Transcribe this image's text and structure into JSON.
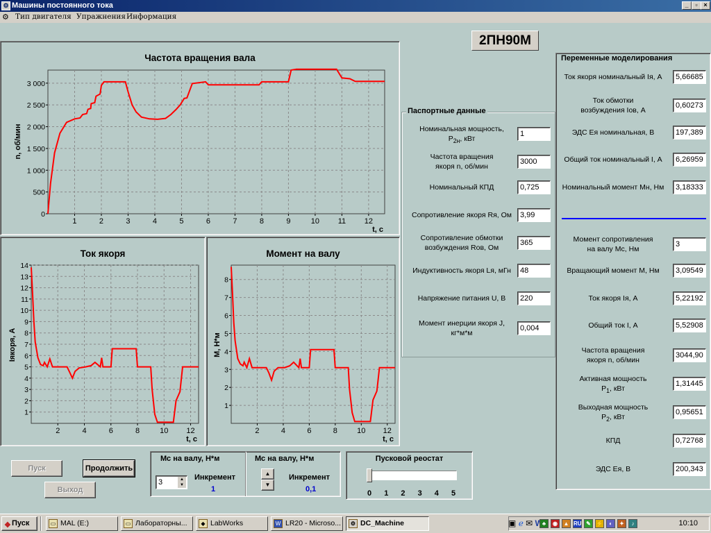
{
  "window": {
    "title": "Машины постоянного тока",
    "icon": "app-icon"
  },
  "menu": [
    "Тип двигателя",
    "Упражнения",
    "Информация"
  ],
  "motor_model": "2ПН90М",
  "charts_text": {
    "speed": {
      "title": "Частота вращения вала",
      "ylabel": "n, об/мин",
      "xlabel": "t, c"
    },
    "current": {
      "title": "Ток якоря",
      "ylabel": "Iякоря, А",
      "xlabel": "t, c"
    },
    "torque": {
      "title": "Момент на валу",
      "ylabel": "М, Н*м",
      "xlabel": "t, c"
    }
  },
  "chart_data": [
    {
      "type": "line",
      "title": "Частота вращения вала",
      "xlabel": "t, c",
      "ylabel": "n, об/мин",
      "xlim": [
        0,
        12.6
      ],
      "ylim": [
        0,
        3300
      ],
      "xticks": [
        1,
        2,
        3,
        4,
        5,
        6,
        7,
        8,
        9,
        10,
        11,
        12
      ],
      "yticks": [
        0,
        500,
        1000,
        1500,
        2000,
        2500,
        3000
      ],
      "ytick_labels": [
        "0",
        "500",
        "1 000",
        "1 500",
        "2 000",
        "2 500",
        "3 000"
      ],
      "grid": true,
      "series": [
        {
          "color": "#ff0000",
          "x": [
            0,
            0.1,
            0.25,
            0.45,
            0.7,
            1.0,
            1.2,
            1.3,
            1.45,
            1.5,
            1.6,
            1.62,
            1.75,
            1.8,
            1.95,
            2.0,
            2.1,
            2.9,
            3.0,
            3.15,
            3.3,
            3.5,
            3.8,
            4.1,
            4.4,
            4.6,
            4.8,
            4.95,
            5.1,
            5.2,
            5.4,
            5.9,
            6.0,
            7.9,
            8.0,
            9.0,
            9.1,
            9.3,
            10.8,
            11.0,
            11.3,
            11.5,
            12.6
          ],
          "y": [
            0,
            700,
            1400,
            1850,
            2100,
            2180,
            2200,
            2280,
            2300,
            2400,
            2420,
            2530,
            2550,
            2700,
            2750,
            2950,
            3030,
            3030,
            2800,
            2500,
            2340,
            2220,
            2180,
            2170,
            2190,
            2280,
            2400,
            2500,
            2650,
            2660,
            2990,
            3030,
            2960,
            2960,
            3030,
            3030,
            3300,
            3320,
            3320,
            3120,
            3100,
            3040,
            3040
          ]
        }
      ]
    },
    {
      "type": "line",
      "title": "Ток якоря",
      "xlabel": "t, c",
      "ylabel": "Iякоря, А",
      "xlim": [
        0,
        12.6
      ],
      "ylim": [
        0,
        14
      ],
      "xticks": [
        2,
        4,
        6,
        8,
        10,
        12
      ],
      "yticks": [
        1,
        2,
        3,
        4,
        5,
        6,
        7,
        8,
        9,
        10,
        11,
        12,
        13,
        14
      ],
      "grid": true,
      "series": [
        {
          "color": "#ff0000",
          "x": [
            0,
            0.1,
            0.2,
            0.3,
            0.5,
            0.7,
            0.9,
            1.0,
            1.2,
            1.4,
            1.6,
            2.0,
            2.4,
            2.7,
            2.9,
            3.1,
            3.3,
            3.6,
            4.1,
            4.5,
            4.8,
            5.2,
            5.3,
            5.4,
            5.5,
            6.0,
            6.1,
            6.2,
            7.9,
            8.0,
            8.2,
            9.0,
            9.1,
            9.3,
            9.5,
            10.0,
            10.7,
            10.9,
            11.2,
            11.4,
            12.6
          ],
          "y": [
            13.8,
            11.5,
            9.0,
            7.2,
            5.8,
            5.2,
            5.1,
            5.4,
            5.0,
            5.7,
            5.0,
            5.0,
            5.0,
            5.0,
            4.5,
            4.0,
            4.6,
            4.9,
            5.0,
            5.1,
            5.4,
            5.0,
            5.8,
            5.0,
            5.0,
            5.0,
            6.6,
            6.6,
            6.6,
            5.0,
            5.0,
            5.0,
            3.0,
            0.8,
            0.1,
            0.1,
            0.1,
            2.0,
            2.8,
            5.0,
            5.0
          ]
        }
      ]
    },
    {
      "type": "line",
      "title": "Момент на валу",
      "xlabel": "t, c",
      "ylabel": "М, Н*м",
      "xlim": [
        0,
        12.6
      ],
      "ylim": [
        0,
        8.8
      ],
      "xticks": [
        2,
        4,
        6,
        8,
        10,
        12
      ],
      "yticks": [
        1,
        2,
        3,
        4,
        5,
        6,
        7,
        8
      ],
      "grid": true,
      "series": [
        {
          "color": "#ff0000",
          "x": [
            0,
            0.1,
            0.2,
            0.3,
            0.5,
            0.7,
            0.9,
            1.0,
            1.2,
            1.4,
            1.6,
            2.0,
            2.4,
            2.7,
            2.9,
            3.1,
            3.3,
            3.6,
            4.1,
            4.5,
            4.8,
            5.2,
            5.3,
            5.4,
            5.5,
            6.0,
            6.1,
            6.2,
            7.9,
            8.0,
            8.2,
            9.0,
            9.1,
            9.3,
            9.5,
            10.0,
            10.7,
            10.9,
            11.2,
            11.4,
            12.6
          ],
          "y": [
            8.7,
            7.2,
            5.6,
            4.6,
            3.6,
            3.3,
            3.2,
            3.4,
            3.1,
            3.6,
            3.1,
            3.1,
            3.1,
            3.1,
            2.8,
            2.4,
            2.9,
            3.1,
            3.1,
            3.2,
            3.4,
            3.1,
            3.6,
            3.1,
            3.1,
            3.1,
            4.1,
            4.1,
            4.1,
            3.1,
            3.1,
            3.1,
            1.9,
            0.6,
            0.1,
            0.1,
            0.1,
            1.3,
            1.8,
            3.1,
            3.1
          ]
        }
      ]
    }
  ],
  "passport": {
    "title": "Паспортные данные",
    "rows": [
      {
        "label": "Номинальная мощность,",
        "label2": "P2н, кВт",
        "value": "1"
      },
      {
        "label": "Частота вращения",
        "label2": "якоря n, об/мин",
        "value": "3000"
      },
      {
        "label": "Номинальный КПД",
        "label2": "",
        "value": "0,725"
      },
      {
        "label": "Сопротивление якоря Rя, Ом",
        "label2": "",
        "value": "3,99"
      },
      {
        "label": "Сопротивление обмотки",
        "label2": "возбуждения Rов, Ом",
        "value": "365"
      },
      {
        "label": "Индуктивность якоря Lя, мГн",
        "label2": "",
        "value": "48"
      },
      {
        "label": "Напряжение питания U, В",
        "label2": "",
        "value": "220"
      },
      {
        "label": "Момент инерции якоря J,",
        "label2": "кг*м*м",
        "value": "0,004"
      }
    ]
  },
  "variables": {
    "title": "Переменные моделирования",
    "rows": [
      {
        "label": "Ток якоря номинальный Iя, А",
        "label2": "",
        "value": "5,66685"
      },
      {
        "label": "Ток обмотки",
        "label2": "возбуждения Iов, А",
        "value": "0,60273"
      },
      {
        "label": "ЭДС Ея номинальная, В",
        "label2": "",
        "value": "197,389"
      },
      {
        "label": "Общий ток номинальный  I, А",
        "label2": "",
        "value": "6,26959"
      },
      {
        "label": "Номинальный момент Мн, Нм",
        "label2": "",
        "value": "3,18333"
      },
      {
        "label": "Момент сопротивления",
        "label2": "на валу Мс, Нм",
        "value": "3"
      },
      {
        "label": "Вращающий момент М, Нм",
        "label2": "",
        "value": "3,09549"
      },
      {
        "label": "Ток якоря Iя, А",
        "label2": "",
        "value": "5,22192"
      },
      {
        "label": "Общий ток I, А",
        "label2": "",
        "value": "5,52908"
      },
      {
        "label": "Частота вращения",
        "label2": "якоря n, об/мин",
        "value": "3044,90"
      },
      {
        "label": "Активная мощность",
        "label2": "P1, кВт",
        "value": "1,31445"
      },
      {
        "label": "Выходная мощность",
        "label2": "P2, кВт",
        "value": "0,95651"
      },
      {
        "label": "КПД",
        "label2": "",
        "value": "0,72768"
      },
      {
        "label": "ЭДС Ея, В",
        "label2": "",
        "value": "200,343"
      }
    ]
  },
  "controls": {
    "start_label": "Пуск",
    "continue_label": "Продолжить",
    "exit_label": "Выход",
    "mc_label": "Мс на валу, Н*м",
    "mc_value": "3",
    "increment_label": "Инкремент",
    "increment1": "1",
    "increment2": "0,1",
    "rheostat_title": "Пусковой реостат",
    "rheostat_ticks": [
      "0",
      "1",
      "2",
      "3",
      "4",
      "5"
    ],
    "rheostat_level": 0
  },
  "taskbar": {
    "start": "Пуск",
    "tasks": [
      "MAL (E:)",
      "Лабораторны...",
      "LabWorks",
      "LR20 - Microso...",
      "DC_Machine"
    ],
    "clock": "10:10"
  }
}
